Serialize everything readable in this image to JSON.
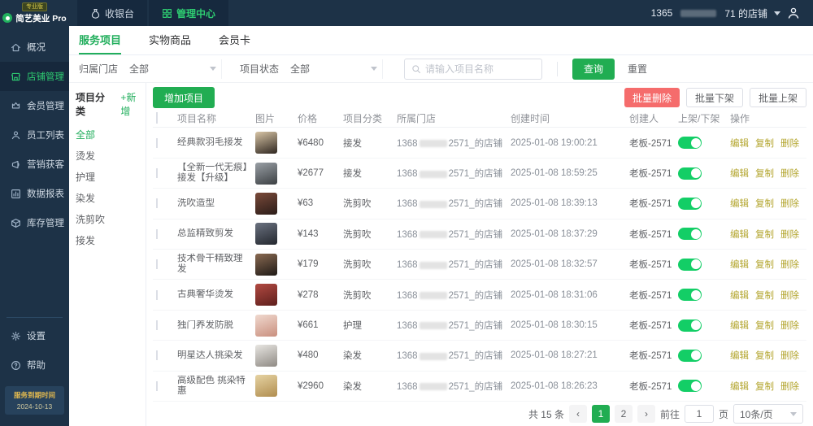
{
  "colors": {
    "navy": "#1d3247",
    "accent_green": "#21ad52",
    "toggle_green": "#13ce66",
    "danger_red": "#f56c6c",
    "action_link": "#b3a52e",
    "expiry_yellow": "#e0b84f"
  },
  "topbar": {
    "plan_badge": "专业版",
    "logo": "简艺美业 Pro",
    "tabs": [
      {
        "label": "收银台"
      },
      {
        "label": "管理中心"
      }
    ],
    "account_prefix": "1365",
    "account_suffix": "71 的店铺"
  },
  "sidebar": {
    "items": [
      {
        "label": "概况",
        "icon": "home-icon"
      },
      {
        "label": "店铺管理",
        "icon": "shop-icon"
      },
      {
        "label": "会员管理",
        "icon": "member-icon"
      },
      {
        "label": "员工列表",
        "icon": "staff-icon"
      },
      {
        "label": "营销获客",
        "icon": "marketing-icon"
      },
      {
        "label": "数据报表",
        "icon": "report-icon"
      },
      {
        "label": "库存管理",
        "icon": "inventory-icon"
      }
    ],
    "footer_items": [
      {
        "label": "设置",
        "icon": "gear-icon"
      },
      {
        "label": "帮助",
        "icon": "help-icon"
      }
    ],
    "expiry_title": "服务到期时间",
    "expiry_date": "2024-10-13"
  },
  "page_tabs": [
    "服务项目",
    "实物商品",
    "会员卡"
  ],
  "filters": {
    "store_label": "归属门店",
    "store_value": "全部",
    "status_label": "项目状态",
    "status_value": "全部",
    "search_placeholder": "请输入项目名称",
    "search_btn": "查询",
    "reset_btn": "重置"
  },
  "toolbar": {
    "category_title": "项目分类",
    "add_category": "+新增",
    "add_item": "增加项目",
    "batch_delete": "批量删除",
    "batch_off": "批量下架",
    "batch_on": "批量上架"
  },
  "categories": [
    "全部",
    "烫发",
    "护理",
    "染发",
    "洗剪吹",
    "接发"
  ],
  "table": {
    "headers": [
      "项目名称",
      "图片",
      "价格",
      "项目分类",
      "所属门店",
      "创建时间",
      "创建人",
      "上架/下架",
      "操作"
    ],
    "actions": [
      "编辑",
      "复制",
      "删除"
    ],
    "store_prefix": "1368",
    "store_suffix": "2571_的店铺",
    "rows": [
      {
        "name": "经典款羽毛接发",
        "price": "¥6480",
        "category": "接发",
        "store_prefix": "1368",
        "store_suffix": "2571_的店铺",
        "time": "2025-01-08 19:00:21",
        "creator": "老板-2571",
        "thumb": [
          "#d8c5a6",
          "#2e2620"
        ]
      },
      {
        "name": "【全新一代无痕】接发【升级】",
        "price": "¥2677",
        "category": "接发",
        "store_prefix": "1368",
        "store_suffix": "2571_的店铺",
        "time": "2025-01-08 18:59:25",
        "creator": "老板-2571",
        "thumb": [
          "#9aa0a6",
          "#3c4043"
        ]
      },
      {
        "name": "洗吹造型",
        "price": "¥63",
        "category": "洗剪吹",
        "store_prefix": "1368",
        "store_suffix": "2571_的店铺",
        "time": "2025-01-08 18:39:13",
        "creator": "老板-2571",
        "thumb": [
          "#7a4a3a",
          "#2a1c18"
        ]
      },
      {
        "name": "总监精致剪发",
        "price": "¥143",
        "category": "洗剪吹",
        "store_prefix": "1368",
        "store_suffix": "2571_的店铺",
        "time": "2025-01-08 18:37:29",
        "creator": "老板-2571",
        "thumb": [
          "#6b7280",
          "#23272e"
        ]
      },
      {
        "name": "技术骨干精致理发",
        "price": "¥179",
        "category": "洗剪吹",
        "store_prefix": "1368",
        "store_suffix": "2571_的店铺",
        "time": "2025-01-08 18:32:57",
        "creator": "老板-2571",
        "thumb": [
          "#8a6a52",
          "#1f1a16"
        ]
      },
      {
        "name": "古典奢华烫发",
        "price": "¥278",
        "category": "洗剪吹",
        "store_prefix": "1368",
        "store_suffix": "2571_的店铺",
        "time": "2025-01-08 18:31:06",
        "creator": "老板-2571",
        "thumb": [
          "#b24a42",
          "#5e1f1c"
        ]
      },
      {
        "name": "独门养发防脱",
        "price": "¥661",
        "category": "护理",
        "store_prefix": "1368",
        "store_suffix": "2571_的店铺",
        "time": "2025-01-08 18:30:15",
        "creator": "老板-2571",
        "thumb": [
          "#f0d9cf",
          "#c98f7e"
        ]
      },
      {
        "name": "明星达人挑染发",
        "price": "¥480",
        "category": "染发",
        "store_prefix": "1368",
        "store_suffix": "2571_的店铺",
        "time": "2025-01-08 18:27:21",
        "creator": "老板-2571",
        "thumb": [
          "#e8e6e2",
          "#8f8a84"
        ]
      },
      {
        "name": "高级配色 挑染特惠",
        "price": "¥2960",
        "category": "染发",
        "store_prefix": "1368",
        "store_suffix": "2571_的店铺",
        "time": "2025-01-08 18:26:23",
        "creator": "老板-2571",
        "thumb": [
          "#e6d3a3",
          "#b08d4f"
        ]
      }
    ]
  },
  "pagination": {
    "total": "共 15 条",
    "prev": "‹",
    "next": "›",
    "pages": [
      "1",
      "2"
    ],
    "current_page": "1",
    "goto_label": "前往",
    "goto_value": "1",
    "page_unit": "页",
    "per_page": "10条/页"
  }
}
